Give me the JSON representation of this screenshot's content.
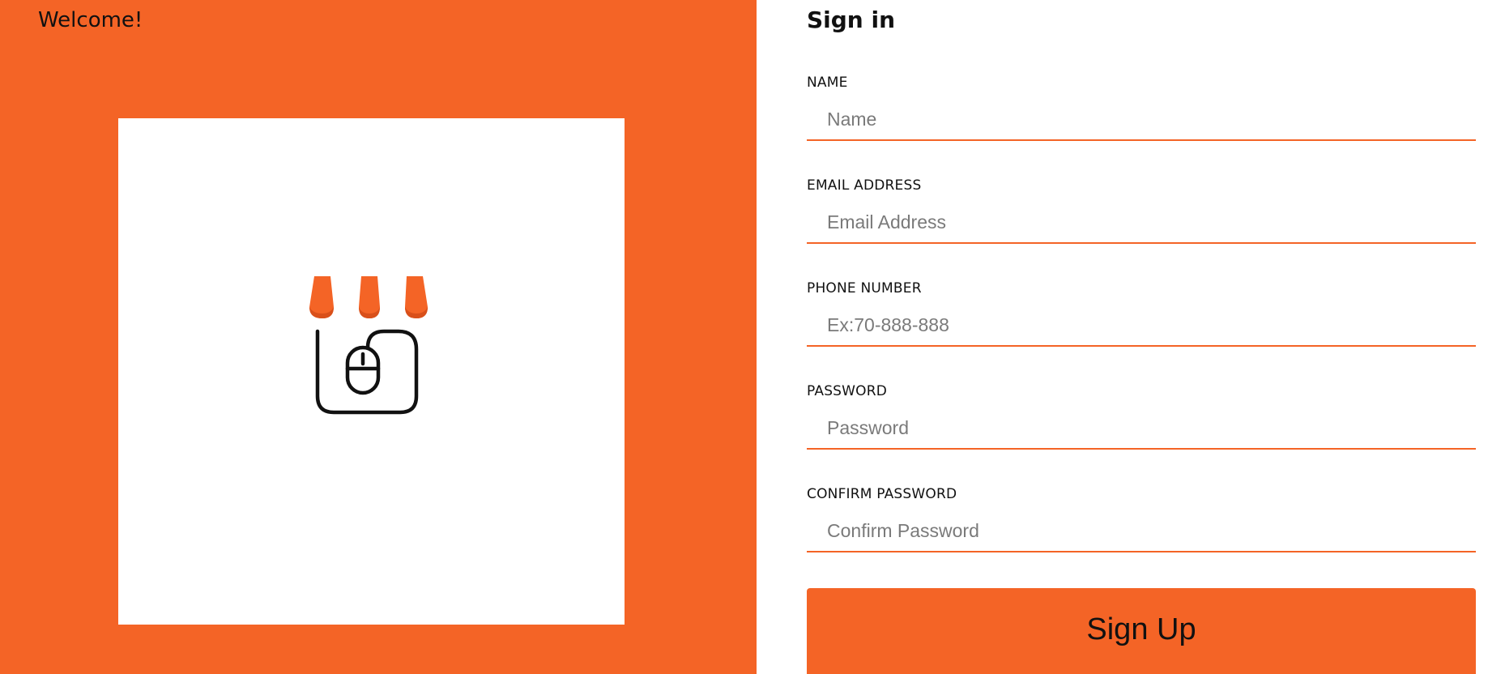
{
  "welcome": {
    "text": "Welcome!"
  },
  "logo": {
    "icon": "shop-mouse-logo-icon",
    "awning_color": "#f46426",
    "outline_color": "#111111"
  },
  "form": {
    "title": "Sign in",
    "fields": [
      {
        "label": "NAME",
        "placeholder": "Name",
        "value": ""
      },
      {
        "label": "EMAIL ADDRESS",
        "placeholder": "Email Address",
        "value": ""
      },
      {
        "label": "PHONE NUMBER",
        "placeholder": "Ex:70-888-888",
        "value": ""
      },
      {
        "label": "PASSWORD",
        "placeholder": "Password",
        "value": ""
      },
      {
        "label": "CONFIRM PASSWORD",
        "placeholder": "Confirm Password",
        "value": ""
      }
    ],
    "submit_label": "Sign Up"
  },
  "colors": {
    "accent": "#f46426",
    "text": "#111111",
    "placeholder": "#7a7a7a",
    "background": "#ffffff"
  }
}
